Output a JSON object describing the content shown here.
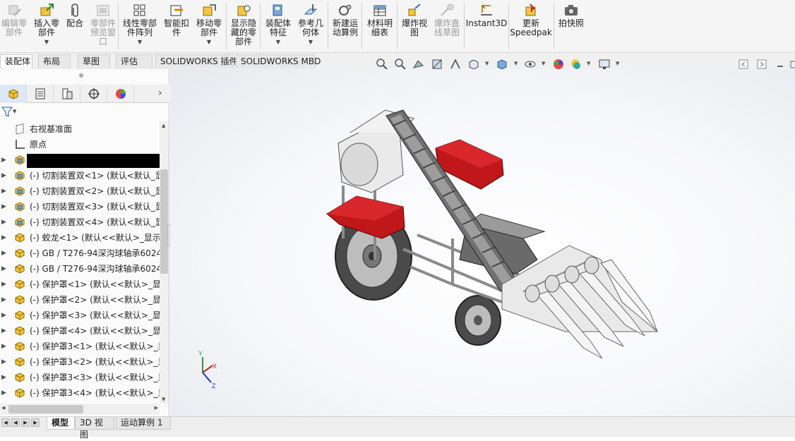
{
  "ribbon": {
    "buttons": [
      {
        "label": "编辑零\n部件",
        "enabled": false
      },
      {
        "label": "插入零\n部件",
        "enabled": true
      },
      {
        "label": "配合",
        "enabled": true
      },
      {
        "label": "零部件\n预览窗\n口",
        "enabled": false
      },
      {
        "label": "线性零部\n件阵列",
        "enabled": true
      },
      {
        "label": "智能扣\n件",
        "enabled": true
      },
      {
        "label": "移动零\n部件",
        "enabled": true
      },
      {
        "label": "显示隐\n藏的零\n部件",
        "enabled": true
      },
      {
        "label": "装配体\n特征",
        "enabled": true
      },
      {
        "label": "参考几\n何体",
        "enabled": true
      },
      {
        "label": "新建运\n动算例",
        "enabled": true
      },
      {
        "label": "材料明\n细表",
        "enabled": true
      },
      {
        "label": "爆炸视\n图",
        "enabled": true
      },
      {
        "label": "爆炸直\n线草图",
        "enabled": false
      },
      {
        "label": "Instant3D",
        "enabled": true
      },
      {
        "label": "更新\nSpeedpak",
        "enabled": true
      },
      {
        "label": "拍快照",
        "enabled": true
      }
    ]
  },
  "tabs": [
    {
      "label": "装配体",
      "active": true
    },
    {
      "label": "布局",
      "active": false
    },
    {
      "label": "草图",
      "active": false
    },
    {
      "label": "评估",
      "active": false
    },
    {
      "label": "SOLIDWORKS 插件",
      "active": false
    },
    {
      "label": "SOLIDWORKS MBD",
      "active": false
    }
  ],
  "feature_tree": {
    "rows": [
      {
        "text": "右视基准面",
        "icon": "plane-icon",
        "expandable": false
      },
      {
        "text": "原点",
        "icon": "origin-icon",
        "expandable": false
      },
      {
        "text": "",
        "icon": "subassembly-icon",
        "expandable": true,
        "redacted": true
      },
      {
        "text": "(-) 切割装置双<1> (默认<默认_显",
        "icon": "subassembly-icon",
        "expandable": true
      },
      {
        "text": "(-) 切割装置双<2> (默认<默认_显",
        "icon": "subassembly-icon",
        "expandable": true
      },
      {
        "text": "(-) 切割装置双<3> (默认<默认_显",
        "icon": "subassembly-icon",
        "expandable": true
      },
      {
        "text": "(-) 切割装置双<4> (默认<默认_显",
        "icon": "subassembly-icon",
        "expandable": true
      },
      {
        "text": "(-) 蛟龙<1> (默认<<默认>_显示状",
        "icon": "part-icon",
        "expandable": true
      },
      {
        "text": "(-) GB / T276-94深沟球轴承6024",
        "icon": "part-icon",
        "expandable": true
      },
      {
        "text": "(-) GB / T276-94深沟球轴承6024",
        "icon": "part-icon",
        "expandable": true
      },
      {
        "text": "(-) 保护罩<1> (默认<<默认>_显示",
        "icon": "part-icon",
        "expandable": true
      },
      {
        "text": "(-) 保护罩<2> (默认<<默认>_显示",
        "icon": "part-icon",
        "expandable": true
      },
      {
        "text": "(-) 保护罩<3> (默认<<默认>_显示",
        "icon": "part-icon",
        "expandable": true
      },
      {
        "text": "(-) 保护罩<4> (默认<<默认>_显示",
        "icon": "part-icon",
        "expandable": true
      },
      {
        "text": "(-) 保护罩3<1> (默认<<默认>_显",
        "icon": "part-icon",
        "expandable": true
      },
      {
        "text": "(-) 保护罩3<2> (默认<<默认>_显",
        "icon": "part-icon",
        "expandable": true
      },
      {
        "text": "(-) 保护罩3<3> (默认<<默认>_显",
        "icon": "part-icon",
        "expandable": true
      },
      {
        "text": "(-) 保护罩3<4> (默认<<默认>_显",
        "icon": "part-icon",
        "expandable": true
      }
    ]
  },
  "bottom_tabs": [
    {
      "label": "模型",
      "active": true
    },
    {
      "label": "3D 视图",
      "active": false
    },
    {
      "label": "运动算例 1",
      "active": false
    }
  ],
  "triad": {
    "x": "X",
    "y": "Y",
    "z": "Z"
  },
  "colors": {
    "accent_red": "#c0171b",
    "frame_grey": "#9a9a9a",
    "tab_active": "#ffffff"
  }
}
